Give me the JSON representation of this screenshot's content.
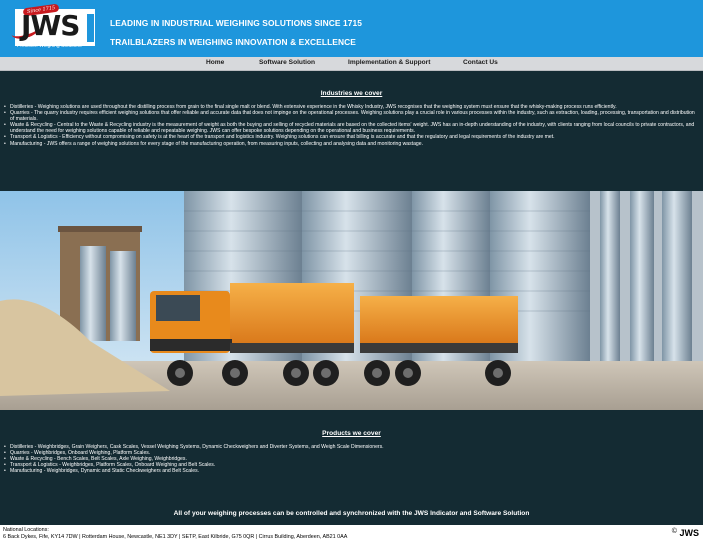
{
  "header": {
    "logo": {
      "since": "Since 1715",
      "brand": "JWS",
      "tagline": "Precision Weighing Solutions"
    },
    "line1": "LEADING IN INDUSTRIAL WEIGHING SOLUTIONS SINCE 1715",
    "line2": "TRAILBLAZERS IN WEIGHING INNOVATION & EXCELLENCE"
  },
  "nav": {
    "items": [
      {
        "label": "Home"
      },
      {
        "label": "Software Solution"
      },
      {
        "label": "Implementation & Support"
      },
      {
        "label": "Contact Us"
      }
    ]
  },
  "industries": {
    "title": "Industries we cover",
    "items": [
      "Distilleries - Weighing solutions are used throughout the distilling process from grain to the final single malt or blend. With extensive experience in the Whisky Industry, JWS recognises that the weighing system must ensure that the whisky-making process runs efficiently.",
      "Quarries - The quarry industry requires efficient weighing solutions that offer reliable and accurate data that does not impinge on the operational processes. Weighing solutions play a crucial role in various processes within the industry, such as extraction, loading, processing, transportation and distribution of materials.",
      "Waste & Recycling - Central to the Waste & Recycling industry is the measurement of weight as both the buying and selling of recycled materials are based on the collected items' weight. JWS has an in-depth understanding of the industry, with clients ranging from local councils to private contractors, and understand the need for weighing solutions capable of reliable and repeatable weighing. JWS can offer bespoke solutions depending on the operational and business requirements.",
      "Transport & Logistics - Efficiency without compromising on safety is at the heart of the transport and logistics industry. Weighing solutions can ensure that billing is accurate and that the regulatory and legal requirements of the industry are met.",
      "Manufacturing - JWS offers a range of weighing solutions for every stage of the manufacturing operation, from measuring inputs, collecting and analysing data and monitoring wastage."
    ]
  },
  "products": {
    "title": "Products we cover",
    "items": [
      "Distilleries - Weighbridges, Grain Weighers, Cask Scales, Vessel Weighing Systems, Dynamic Checkweighers and Diverter Systems, and Weigh Scale Dimensioners.",
      "Quarries - Weighbridges, Onboard Weighing, Platform Scales.",
      "Waste & Recycling - Bench Scales, Belt Scales, Axle Weighing, Weighbridges.",
      "Transport & Logistics - Weighbridges, Platform Scales, Onboard Weighing and Belt Scales.",
      "Manufacturing - Weighbridges, Dynamic and Static Checkweighers and Belt Scales."
    ]
  },
  "tagline": "All of your weighing processes can be controlled and synchronized with the JWS Indicator and Software Solution",
  "footer": {
    "label": "National Locations:",
    "addresses": "6 Back Dykes, Fife, KY14 7DW | Rotterdam House, Newcastle, NE1 3DY | SETP, East Kilbride, G75 0QR | Cirrus Building, Aberdeen, AB21 0AA",
    "copyright_symbol": "©",
    "copyright_brand": "JWS"
  },
  "colors": {
    "header_blue": "#1e96dc",
    "nav_grey": "#d7d9dc",
    "section_dark": "#142b33",
    "logo_red": "#c8191e",
    "truck_orange": "#e88a1c"
  },
  "image": {
    "content": "orange-dump-truck-at-grain-silos-photo"
  }
}
